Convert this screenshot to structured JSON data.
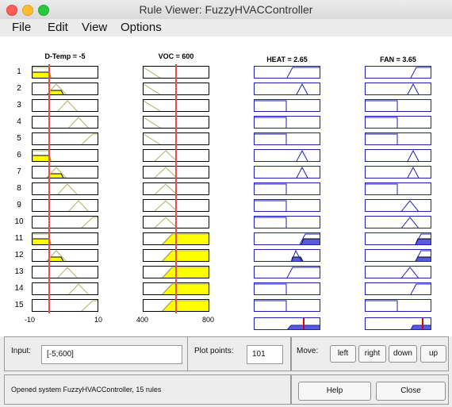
{
  "window": {
    "title": "Rule Viewer: FuzzyHVACController"
  },
  "menu": [
    "File",
    "Edit",
    "View",
    "Options"
  ],
  "inputs": [
    {
      "header": "D-Temp = -5",
      "range": [
        -10,
        10
      ],
      "value": -5,
      "tick_min": "-10",
      "tick_max": "10"
    },
    {
      "header": "VOC = 600",
      "range": [
        400,
        800
      ],
      "value": 600,
      "tick_min": "400",
      "tick_max": "800"
    }
  ],
  "outputs": [
    {
      "header": "HEAT = 2.65"
    },
    {
      "header": "FAN = 3.65"
    }
  ],
  "rule_numbers": [
    "1",
    "2",
    "3",
    "4",
    "5",
    "6",
    "7",
    "8",
    "9",
    "10",
    "11",
    "12",
    "13",
    "14",
    "15"
  ],
  "colors": {
    "fill": "#ffff00",
    "mf_line": "#b0b060",
    "out_fill": "#5a5add",
    "out_border": "#1f1fb3",
    "value_line": "#ea4b4b",
    "out_value_line": "#e00000"
  },
  "bottom": {
    "input_label": "Input:",
    "input_value": "[-5;600]",
    "plot_points_label": "Plot points:",
    "plot_points_value": "101",
    "move_label": "Move:",
    "move_buttons": [
      "left",
      "right",
      "down",
      "up"
    ],
    "status": "Opened system FuzzyHVACController, 15 rules",
    "help": "Help",
    "close": "Close"
  }
}
